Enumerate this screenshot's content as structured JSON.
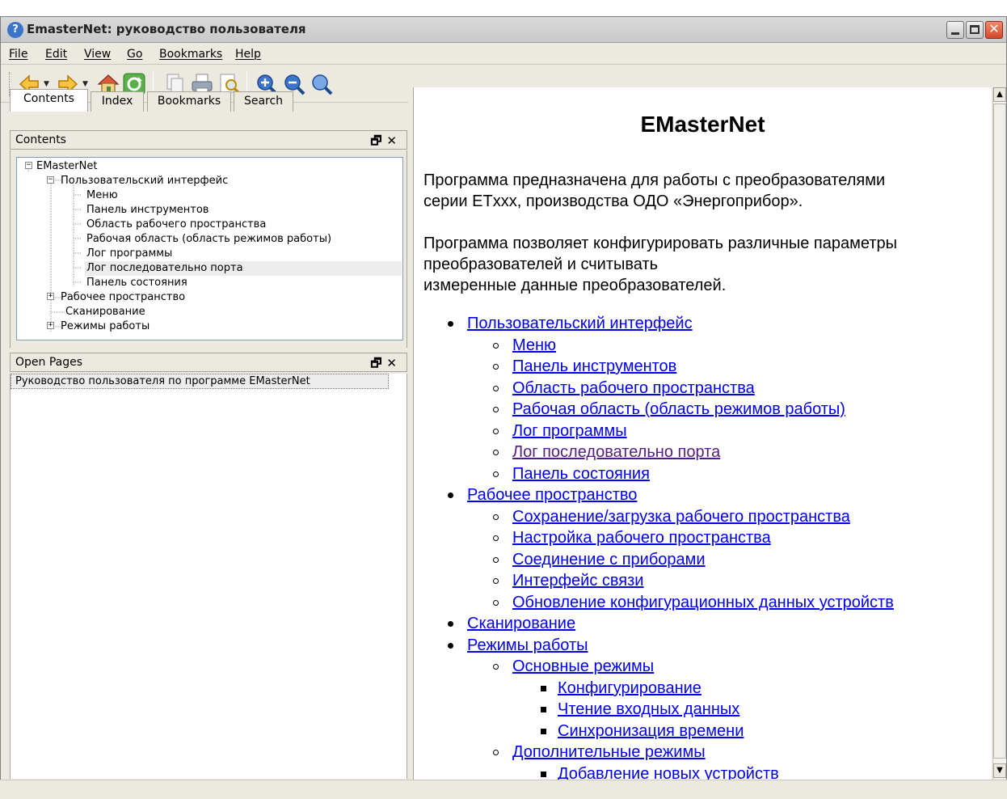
{
  "window": {
    "title": "EmasterNet: руководство пользователя"
  },
  "menu": [
    "File",
    "Edit",
    "View",
    "Go",
    "Bookmarks",
    "Help"
  ],
  "toolbar": {
    "icons": [
      "back-icon",
      "forward-icon",
      "home-icon",
      "sync-icon",
      "copy-icon",
      "print-icon",
      "find-icon",
      "zoom-in-icon",
      "zoom-out-icon",
      "zoom-reset-icon"
    ]
  },
  "tabs": [
    "Contents",
    "Index",
    "Bookmarks",
    "Search"
  ],
  "contents_panel": {
    "title": "Contents",
    "tree": [
      "EMasterNet",
      "Пользовательский интерфейс",
      "Меню",
      "Панель инструментов",
      "Область рабочего пространства",
      "Рабочая область (область режимов работы)",
      "Лог программы",
      "Лог последовательно порта",
      "Панель состояния",
      "Рабочее пространство",
      "Сканирование",
      "Режимы работы"
    ]
  },
  "open_pages": {
    "title": "Open Pages",
    "items": [
      "Руководство пользователя по программе EMasterNet"
    ]
  },
  "doc": {
    "title": "EMasterNet",
    "para1_line1": "Программа предназначена для работы с преобразователями",
    "para1_line2": "серии ETxxx, производства ОДО «Энергоприбор».",
    "para2_line1": "Программа позволяет конфигурировать различные параметры",
    "para2_line2": "преобразователей и считывать",
    "para2_line3": "измеренные данные преобразователей.",
    "links": [
      "Пользовательский интерфейс",
      "Меню",
      "Панель инструментов",
      "Область рабочего пространства",
      "Рабочая область (область режимов работы)",
      "Лог программы",
      "Лог последовательно порта",
      "Панель состояния",
      "Рабочее пространство",
      "Сохранение/загрузка рабочего пространства",
      "Настройка рабочего пространства",
      "Соединение с приборами",
      "Интерфейс связи",
      "Обновление конфигурационных данных устройств",
      "Сканирование",
      "Режимы работы",
      "Основные режимы",
      "Конфигурирование",
      "Чтение входных данных",
      "Синхронизация времени",
      "Дополнительные режимы",
      "Добавление новых устройств"
    ]
  },
  "colors": {
    "link": "#0000ee",
    "visited_link": "#551a8b",
    "chrome": "#ebe9e0"
  }
}
